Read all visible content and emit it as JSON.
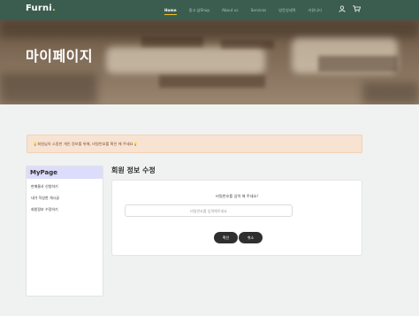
{
  "brand": {
    "name": "Furni",
    "dot": "."
  },
  "nav": {
    "items": [
      {
        "label": "Home",
        "active": true
      },
      {
        "label": "중고 샵Shop",
        "active": false
      },
      {
        "label": "About us",
        "active": false
      },
      {
        "label": "Services",
        "active": false
      },
      {
        "label": "방문상세력",
        "active": false
      },
      {
        "label": "커뮤니티",
        "active": false
      }
    ],
    "icons": [
      "user-icon",
      "cart-icon"
    ]
  },
  "hero": {
    "title": "마이페이지"
  },
  "notice": {
    "text": "💡회원님의 소중한 개인 정보를 위해, 비밀번호를 확인 해 주세요💡"
  },
  "sidebar": {
    "title": "MyPage",
    "items": [
      {
        "label": "판매물사 신청하기"
      },
      {
        "label": "내가 작성한 게시글"
      },
      {
        "label": "회원정보 수정하기"
      }
    ]
  },
  "main": {
    "title": "회원 정보 수정",
    "prompt": "비밀번호를 입력 해 주세요!",
    "password_placeholder": "비밀번호를 입력해주세요",
    "password_value": "",
    "confirm_label": "확인",
    "cancel_label": "취소"
  },
  "colors": {
    "nav_bg": "#3b5d50",
    "accent": "#f9bf29",
    "notice_bg": "#f8e3d2",
    "sidebar_head_bg": "#dcdcfb",
    "button_bg": "#2f2f2f"
  }
}
